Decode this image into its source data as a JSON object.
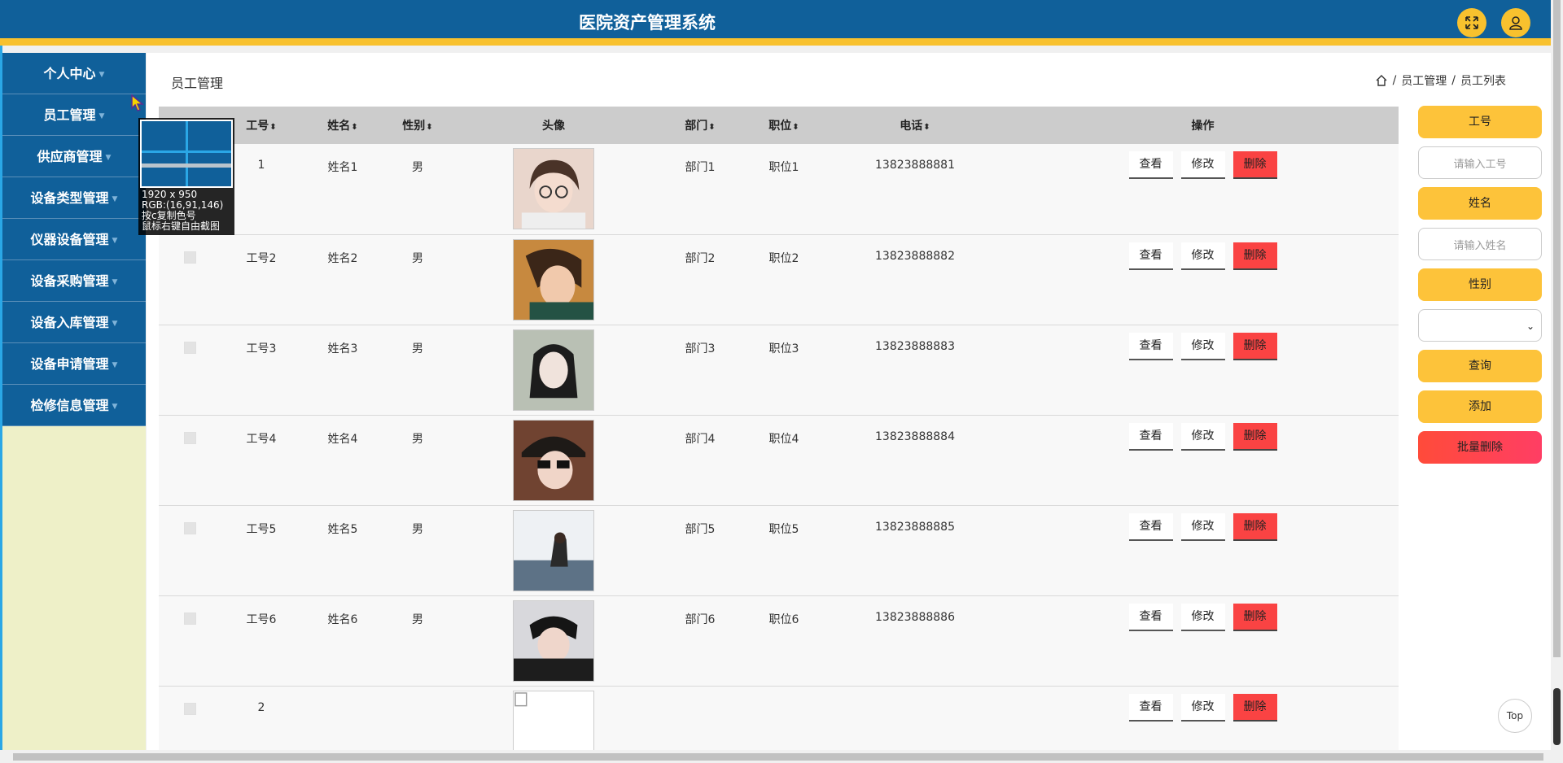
{
  "app": {
    "title": "医院资产管理系统"
  },
  "header": {
    "fullscreen_icon": "expand-icon",
    "user_icon": "user-icon"
  },
  "sidebar": {
    "items": [
      {
        "label": "个人中心"
      },
      {
        "label": "员工管理"
      },
      {
        "label": "供应商管理"
      },
      {
        "label": "设备类型管理"
      },
      {
        "label": "仪器设备管理"
      },
      {
        "label": "设备采购管理"
      },
      {
        "label": "设备入库管理"
      },
      {
        "label": "设备申请管理"
      },
      {
        "label": "检修信息管理"
      }
    ]
  },
  "page": {
    "title": "员工管理",
    "breadcrumb": [
      "员工管理",
      "员工列表"
    ]
  },
  "table": {
    "headers": {
      "id": "工号",
      "name": "姓名",
      "gender": "性别",
      "avatar": "头像",
      "dept": "部门",
      "position": "职位",
      "phone": "电话",
      "ops": "操作"
    },
    "actions": {
      "view": "查看",
      "edit": "修改",
      "delete": "删除"
    },
    "rows": [
      {
        "id": "1",
        "name": "姓名1",
        "gender": "男",
        "dept": "部门1",
        "position": "职位1",
        "phone": "13823888881"
      },
      {
        "id": "工号2",
        "name": "姓名2",
        "gender": "男",
        "dept": "部门2",
        "position": "职位2",
        "phone": "13823888882"
      },
      {
        "id": "工号3",
        "name": "姓名3",
        "gender": "男",
        "dept": "部门3",
        "position": "职位3",
        "phone": "13823888883"
      },
      {
        "id": "工号4",
        "name": "姓名4",
        "gender": "男",
        "dept": "部门4",
        "position": "职位4",
        "phone": "13823888884"
      },
      {
        "id": "工号5",
        "name": "姓名5",
        "gender": "男",
        "dept": "部门5",
        "position": "职位5",
        "phone": "13823888885"
      },
      {
        "id": "工号6",
        "name": "姓名6",
        "gender": "男",
        "dept": "部门6",
        "position": "职位6",
        "phone": "13823888886"
      },
      {
        "id": "2",
        "name": "",
        "gender": "",
        "dept": "",
        "position": "",
        "phone": ""
      }
    ]
  },
  "search": {
    "id_label": "工号",
    "id_placeholder": "请输入工号",
    "name_label": "姓名",
    "name_placeholder": "请输入姓名",
    "gender_label": "性别",
    "gender_selected": "",
    "query_button": "查询",
    "add_button": "添加",
    "batch_delete_button": "批量删除"
  },
  "picker": {
    "size": "1920 x 950",
    "rgb": "RGB:(16,91,146)",
    "hint1": "按c复制色号",
    "hint2": "鼠标右键自由截图"
  },
  "top_button": "Top",
  "colors": {
    "header": "#10609a",
    "accent": "#f8c12e",
    "sidebar_bg": "#eef0c8",
    "delete": "#fa4343"
  }
}
